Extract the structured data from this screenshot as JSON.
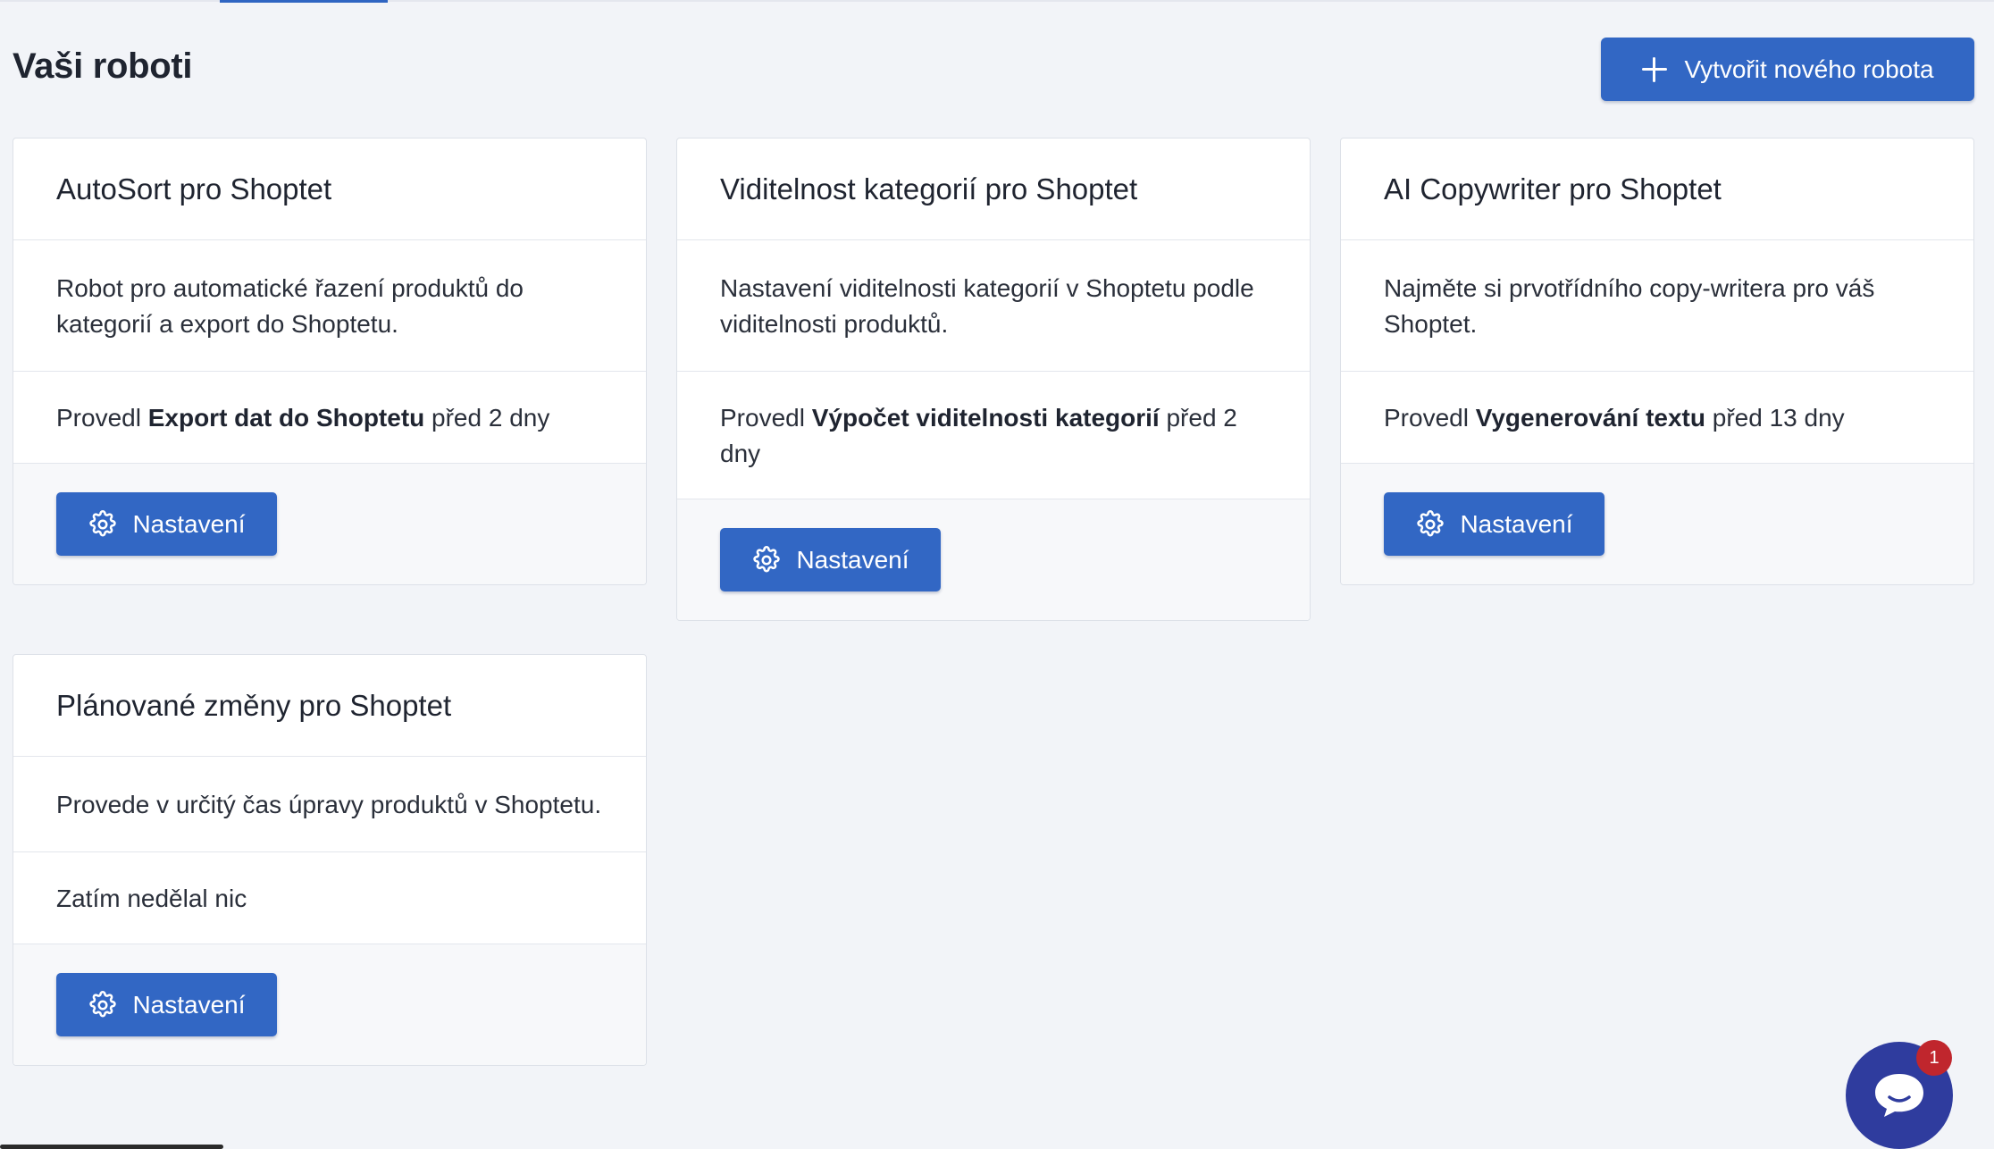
{
  "header": {
    "title": "Vaši roboti",
    "create_button_label": "Vytvořit nového robota"
  },
  "robots": [
    {
      "name": "AutoSort pro Shoptet",
      "description": "Robot pro automatické řazení produktů do kategorií a export do Shoptetu.",
      "activity_prefix": "Provedl",
      "activity_action": "Export dat do Shoptetu",
      "activity_suffix": "před 2 dny",
      "settings_label": "Nastavení"
    },
    {
      "name": "Viditelnost kategorií pro Shoptet",
      "description": "Nastavení viditelnosti kategorií v Shoptetu podle viditelnosti produktů.",
      "activity_prefix": "Provedl",
      "activity_action": "Výpočet viditelnosti kategorií",
      "activity_suffix": "před 2 dny",
      "settings_label": "Nastavení"
    },
    {
      "name": "AI Copywriter pro Shoptet",
      "description": "Najměte si prvotřídního copy-writera pro váš Shoptet.",
      "activity_prefix": "Provedl",
      "activity_action": "Vygenerování textu",
      "activity_suffix": "před 13 dny",
      "settings_label": "Nastavení"
    },
    {
      "name": "Plánované změny pro Shoptet",
      "description": "Provede v určitý čas úpravy produktů v Shoptetu.",
      "activity_text": "Zatím nedělal nic",
      "settings_label": "Nastavení"
    }
  ],
  "chat": {
    "badge_count": "1",
    "icon": "chat-bubble-icon"
  },
  "colors": {
    "primary": "#3267c4",
    "background": "#f2f4f8",
    "chat": "#2f3c9e",
    "badge": "#c0262d"
  }
}
